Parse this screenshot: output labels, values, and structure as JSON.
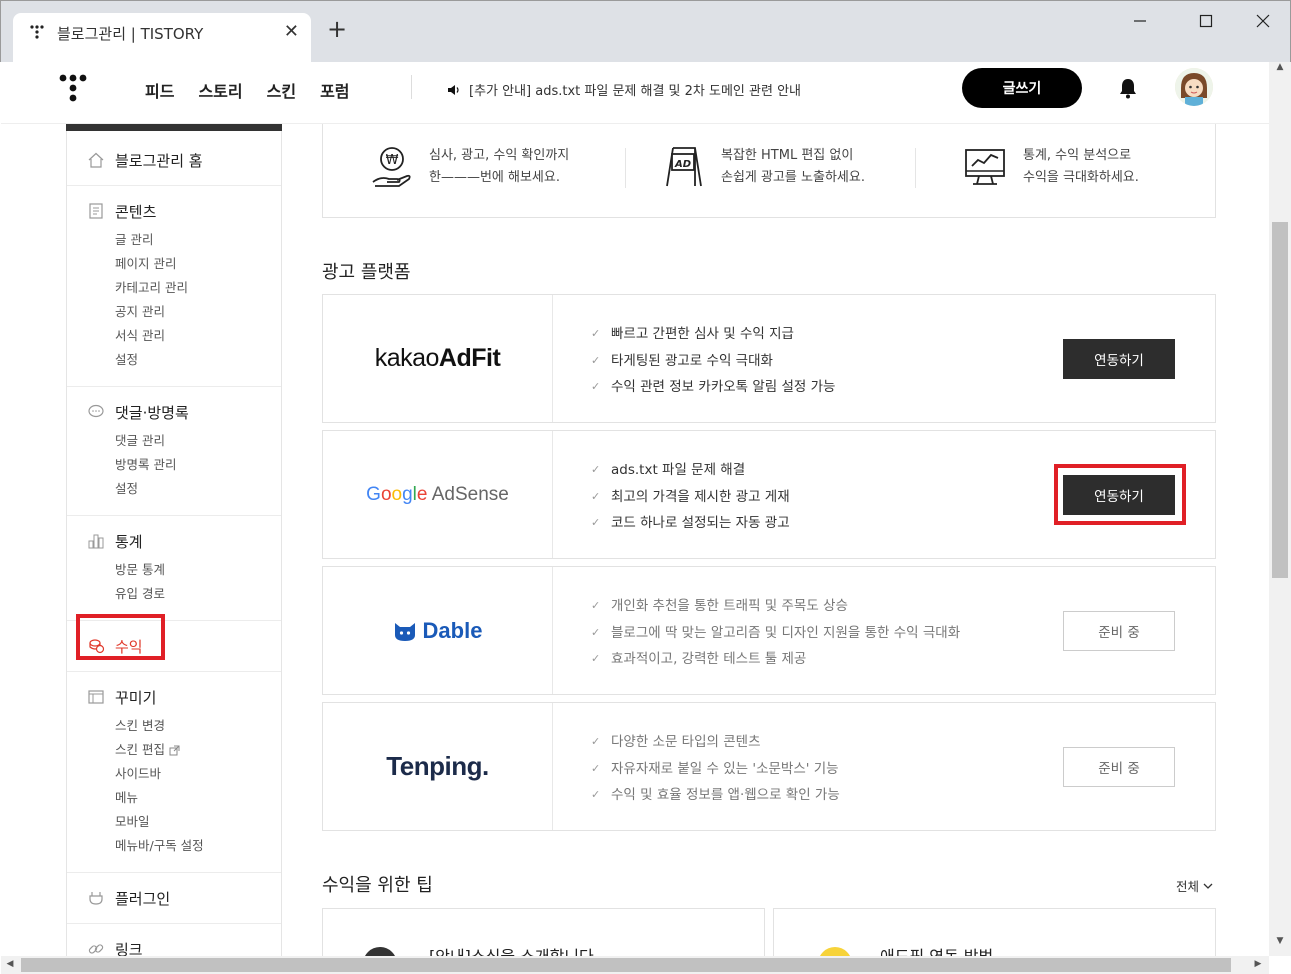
{
  "browser": {
    "tab_title": "블로그관리 | TISTORY",
    "close_glyph": "✕",
    "new_tab_glyph": "+",
    "minimize_glyph": "—",
    "maximize_glyph": "☐",
    "window_close_glyph": "✕"
  },
  "header": {
    "nav": [
      "피드",
      "스토리",
      "스킨",
      "포럼"
    ],
    "notice": "[추가 안내] ads.txt 파일 문제 해결 및 2차 도메인 관련 안내",
    "write_label": "글쓰기"
  },
  "sidebar": {
    "home": "블로그관리 홈",
    "content": {
      "label": "콘텐츠",
      "items": [
        "글 관리",
        "페이지 관리",
        "카테고리 관리",
        "공지 관리",
        "서식 관리",
        "설정"
      ]
    },
    "comments": {
      "label": "댓글·방명록",
      "items": [
        "댓글 관리",
        "방명록 관리",
        "설정"
      ]
    },
    "stats": {
      "label": "통계",
      "items": [
        "방문 통계",
        "유입 경로"
      ]
    },
    "revenue": {
      "label": "수익"
    },
    "design": {
      "label": "꾸미기",
      "items": [
        "스킨 변경",
        "스킨 편집",
        "사이드바",
        "메뉴",
        "모바일",
        "메뉴바/구독 설정"
      ]
    },
    "plugin": {
      "label": "플러그인"
    },
    "link": {
      "label": "링크"
    }
  },
  "features": [
    {
      "icon": "won-hand-icon",
      "line1": "심사, 광고, 수익 확인까지",
      "line2": "한———번에 해보세요."
    },
    {
      "icon": "ad-board-icon",
      "line1": "복잡한 HTML 편집 없이",
      "line2": "손쉽게 광고를 노출하세요."
    },
    {
      "icon": "chart-monitor-icon",
      "line1": "통계, 수익 분석으로",
      "line2": "수익을 극대화하세요."
    }
  ],
  "platform_section_title": "광고 플랫폼",
  "platforms": [
    {
      "name": "kakaoAdFit",
      "logo_light": "kakao",
      "logo_bold": "AdFit",
      "features": [
        "빠르고 간편한 심사 및 수익 지급",
        "타게팅된 광고로 수익 극대화",
        "수익 관련 정보 카카오톡 알림 설정 가능"
      ],
      "button": "연동하기",
      "state": "active"
    },
    {
      "name": "Google AdSense",
      "logo_word": "AdSense",
      "features": [
        "ads.txt 파일 문제 해결",
        "최고의 가격을 제시한 광고 게재",
        "코드 하나로 설정되는 자동 광고"
      ],
      "button": "연동하기",
      "state": "active"
    },
    {
      "name": "Dable",
      "logo_word": "Dable",
      "features": [
        "개인화 추천을 통한 트래픽 및 주목도 상승",
        "블로그에 딱 맞는 알고리즘 및 디자인 지원을 통한 수익 극대화",
        "효과적이고, 강력한 테스트 툴 제공"
      ],
      "button": "준비 중",
      "state": "pending"
    },
    {
      "name": "Tenping.",
      "logo_word": "Tenping.",
      "features": [
        "다양한 소문 타입의 콘텐츠",
        "자유자재로 붙일 수 있는 '소문박스' 기능",
        "수익 및 효율 정보를 앱·웹으로 확인 가능"
      ],
      "button": "준비 중",
      "state": "pending"
    }
  ],
  "tips": {
    "title": "수익을 위한 팁",
    "all_label": "전체",
    "card1_partial": "[안내]소식을 소개합니다",
    "card2_partial": "애드핏 연동 방법"
  },
  "colors": {
    "accent_red": "#e01f26",
    "dark_button": "#2d2d2d",
    "dable_blue": "#1a5ab8",
    "tenping_navy": "#1c2b4a"
  }
}
